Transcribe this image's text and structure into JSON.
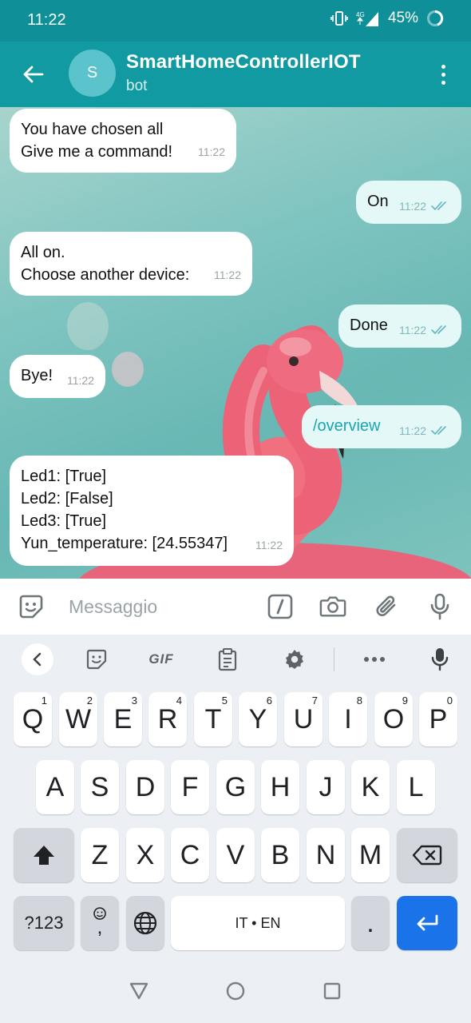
{
  "status": {
    "time": "11:22",
    "network": "4G",
    "battery": "45%"
  },
  "header": {
    "avatar_letter": "S",
    "title": "SmartHomeControllerIOT",
    "subtitle": "bot"
  },
  "messages": [
    {
      "dir": "in",
      "lines": [
        "You have chosen all",
        "Give me a command!"
      ],
      "time": "11:22"
    },
    {
      "dir": "out",
      "lines": [
        "On"
      ],
      "time": "11:22"
    },
    {
      "dir": "in",
      "lines": [
        "All on.",
        "Choose another device:"
      ],
      "time": "11:22"
    },
    {
      "dir": "out",
      "lines": [
        "Done"
      ],
      "time": "11:22"
    },
    {
      "dir": "in",
      "lines": [
        "Bye!"
      ],
      "time": "11:22"
    },
    {
      "dir": "out",
      "lines": [
        "/overview"
      ],
      "time": "11:22",
      "command": true
    },
    {
      "dir": "in",
      "lines": [
        "Led1: [True]",
        "Led2: [False]",
        "Led3: [True]",
        "Yun_temperature: [24.55347]"
      ],
      "time": "11:22"
    }
  ],
  "input": {
    "placeholder": "Messaggio"
  },
  "keyboard": {
    "toolbar": [
      "chevron-left-icon",
      "sticker-icon",
      "GIF",
      "clipboard-icon",
      "gear-icon",
      "more-icon",
      "mic-icon"
    ],
    "row1": [
      {
        "k": "Q",
        "h": "1"
      },
      {
        "k": "W",
        "h": "2"
      },
      {
        "k": "E",
        "h": "3"
      },
      {
        "k": "R",
        "h": "4"
      },
      {
        "k": "T",
        "h": "5"
      },
      {
        "k": "Y",
        "h": "6"
      },
      {
        "k": "U",
        "h": "7"
      },
      {
        "k": "I",
        "h": "8"
      },
      {
        "k": "O",
        "h": "9"
      },
      {
        "k": "P",
        "h": "0"
      }
    ],
    "row2": [
      "A",
      "S",
      "D",
      "F",
      "G",
      "H",
      "J",
      "K",
      "L"
    ],
    "row3": [
      "Z",
      "X",
      "C",
      "V",
      "B",
      "N",
      "M"
    ],
    "symbols": "?123",
    "comma": ",",
    "space": "IT • EN",
    "period": "."
  },
  "colors": {
    "header": "#119aa2",
    "status_bar": "#0f8f98",
    "accent": "#19a6b0",
    "enter": "#1a73e8"
  }
}
